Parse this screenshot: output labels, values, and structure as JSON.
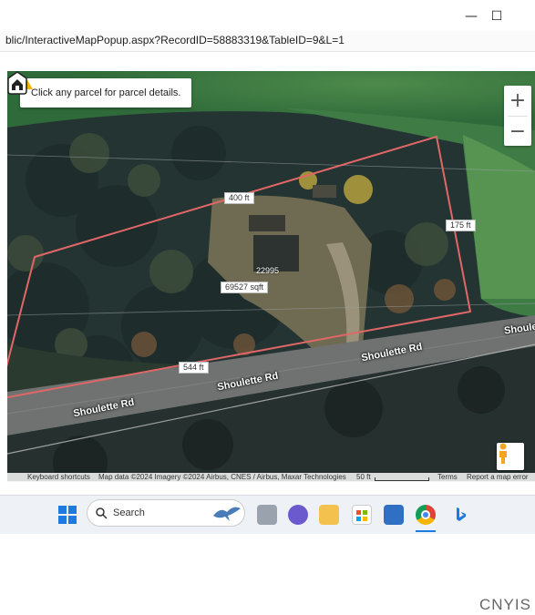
{
  "window": {
    "minimize_glyph": "—",
    "maximize_glyph": "☐"
  },
  "address_bar": {
    "url": "blic/InteractiveMapPopup.aspx?RecordID=58883319&TableID=9&L=1"
  },
  "map": {
    "tooltip": "Click any parcel for parcel details.",
    "zoom_in": "+",
    "zoom_out": "−",
    "dimensions": {
      "top": "400 ft",
      "right": "175 ft",
      "bottom": "544 ft"
    },
    "parcel_id": "22995",
    "area": "69527 sqft",
    "roads": [
      "Shoulette Rd",
      "Shoulette Rd",
      "Shoulette Rd",
      "Shoule"
    ],
    "footer": {
      "shortcuts": "Keyboard shortcuts",
      "attribution": "Map data ©2024 Imagery ©2024 Airbus, CNES / Airbus, Maxar Technologies",
      "scale": "50 ft",
      "terms": "Terms",
      "report": "Report a map error"
    }
  },
  "taskbar": {
    "search_label": "Search"
  },
  "watermark": "CNYIS"
}
